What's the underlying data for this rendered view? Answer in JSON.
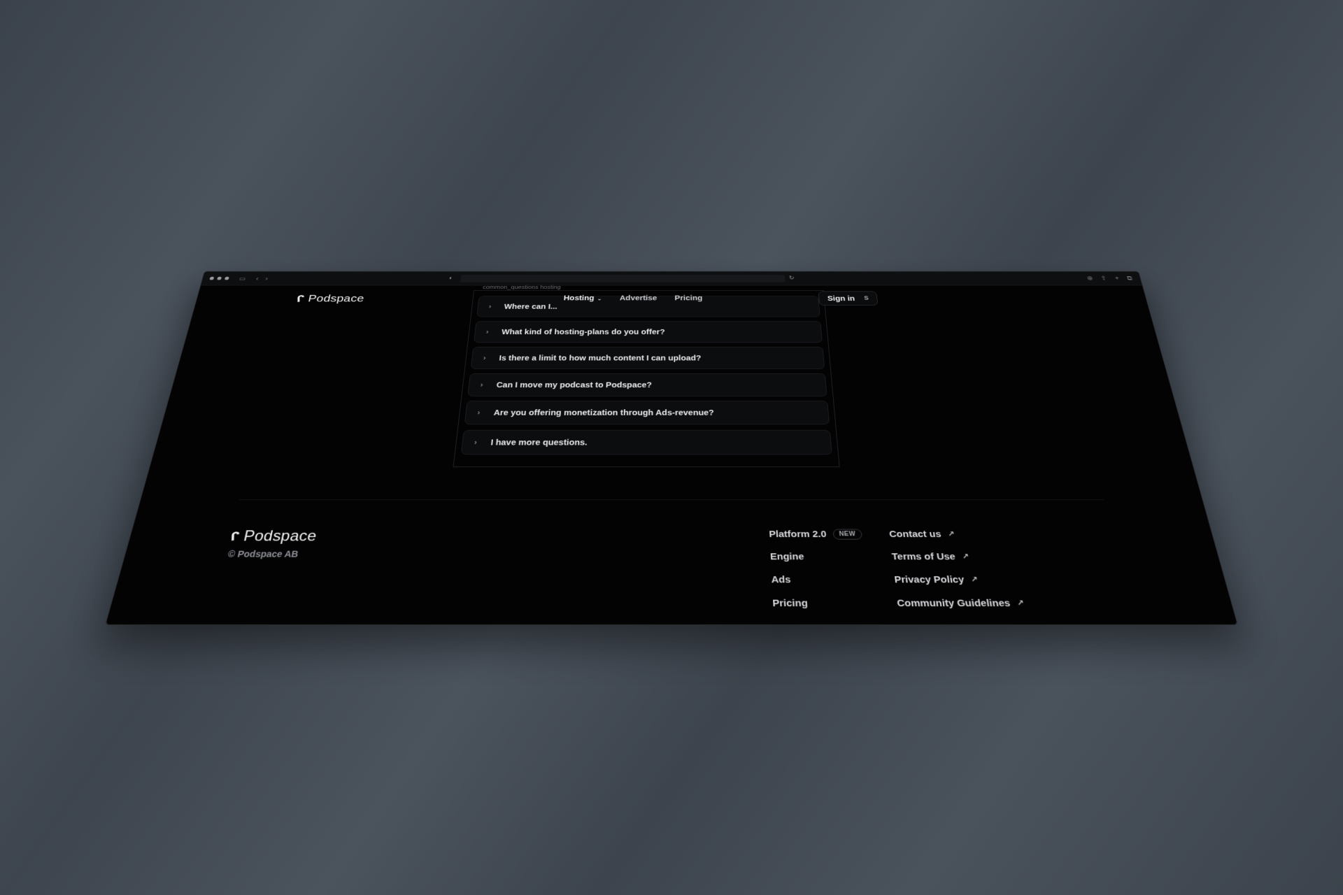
{
  "browser": {
    "icons": [
      "sidebar-icon",
      "back-icon",
      "forward-icon",
      "shield-icon",
      "reload-icon",
      "download-icon",
      "share-icon",
      "new-tab-icon",
      "tabs-icon"
    ]
  },
  "header": {
    "brand": "Podspace",
    "nav": [
      {
        "label": "Hosting",
        "has_dropdown": true
      },
      {
        "label": "Advertise"
      },
      {
        "label": "Pricing"
      }
    ],
    "sign_in": {
      "label": "Sign in",
      "shortcut": "S"
    }
  },
  "faq": {
    "frame_label": "common_questions hosting",
    "items": [
      {
        "question": "Where can I..."
      },
      {
        "question": "What kind of hosting-plans do you offer?"
      },
      {
        "question": "Is there a limit to how much content I can upload?"
      },
      {
        "question": "Can I move my podcast to Podspace?"
      },
      {
        "question": "Are you offering monetization through Ads-revenue?"
      },
      {
        "question": "I have more questions."
      }
    ]
  },
  "footer": {
    "brand": "Podspace",
    "copyright": "© Podspace AB",
    "col_a": [
      {
        "label": "Platform 2.0",
        "badge": "NEW"
      },
      {
        "label": "Engine"
      },
      {
        "label": "Ads"
      },
      {
        "label": "Pricing"
      }
    ],
    "col_b": [
      {
        "label": "Contact us"
      },
      {
        "label": "Terms of Use"
      },
      {
        "label": "Privacy Policy"
      },
      {
        "label": "Community Guidelines"
      }
    ]
  },
  "colors": {
    "background": "#030304",
    "text": "#ececef",
    "muted": "#8d9096"
  }
}
